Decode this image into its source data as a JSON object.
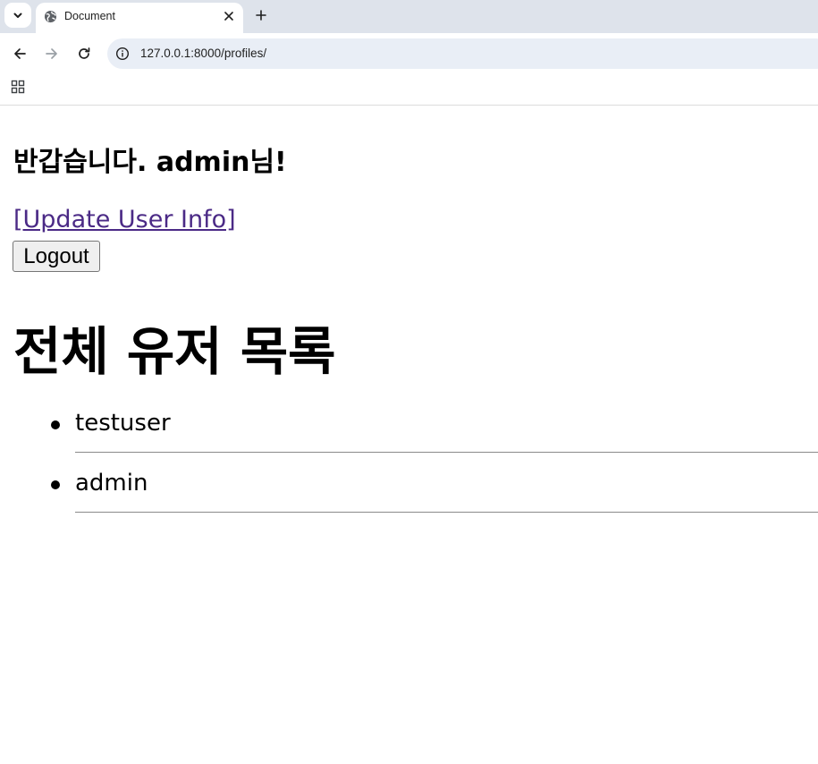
{
  "browser": {
    "tab_title": "Document",
    "url": "127.0.0.1:8000/profiles/",
    "icons": {
      "tab_search": "chevron-down-icon",
      "favicon": "globe-icon",
      "close": "close-icon",
      "new_tab": "plus-icon",
      "back": "arrow-left-icon",
      "forward": "arrow-right-icon",
      "reload": "reload-icon",
      "site_info": "info-icon",
      "apps": "apps-grid-icon"
    }
  },
  "page": {
    "greeting": "반갑습니다. admin님!",
    "update_link": "[Update User Info]",
    "logout_button": "Logout",
    "list_title": "전체 유저 목록",
    "users": [
      "testuser",
      "admin"
    ]
  },
  "colors": {
    "link": "#4b2a86",
    "tabstrip": "#dee3eb",
    "omnibox": "#e9eef6"
  }
}
